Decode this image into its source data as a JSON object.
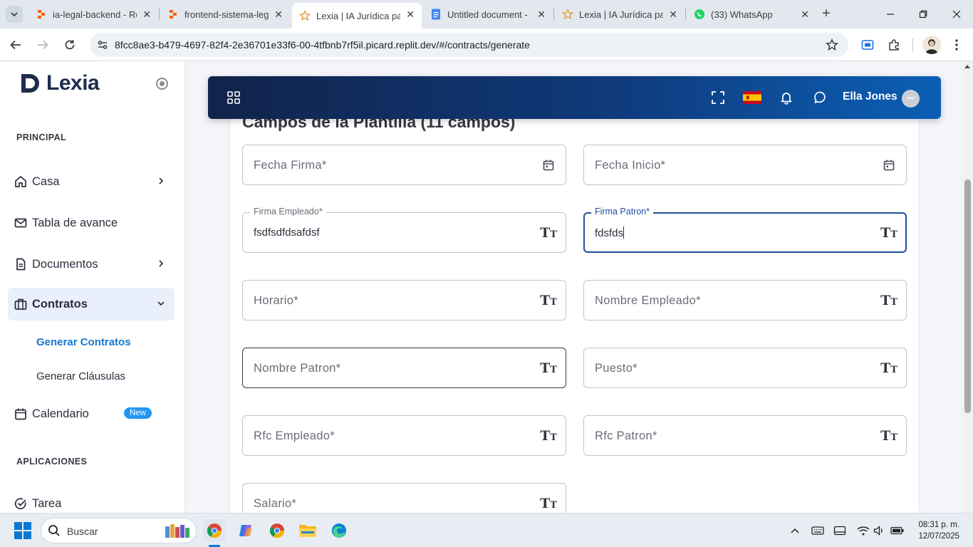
{
  "browser": {
    "tabs": [
      {
        "title": "ia-legal-backend - Re",
        "icon": "replit-icon",
        "active": false
      },
      {
        "title": "frontend-sistema-leg",
        "icon": "replit-icon",
        "active": false
      },
      {
        "title": "Lexia | IA Jurídica par",
        "icon": "star-favicon",
        "active": true
      },
      {
        "title": "Untitled document - ",
        "icon": "google-docs-icon",
        "active": false
      },
      {
        "title": "Lexia | IA Jurídica par",
        "icon": "star-favicon",
        "active": false
      },
      {
        "title": "(33) WhatsApp",
        "icon": "whatsapp-icon",
        "active": false
      }
    ],
    "url": "8fcc8ae3-b479-4697-82f4-2e36701e33f6-00-4tfbnb7rf5il.picard.replit.dev/#/contracts/generate"
  },
  "sidebar": {
    "brand": "Lexia",
    "section_principal": "PRINCIPAL",
    "section_apps": "APLICACIONES",
    "items": [
      {
        "label": "Casa",
        "icon": "home-icon"
      },
      {
        "label": "Tabla de avance",
        "icon": "mail-icon"
      },
      {
        "label": "Documentos",
        "icon": "document-icon"
      },
      {
        "label": "Contratos",
        "icon": "briefcase-icon"
      },
      {
        "label": "Calendario",
        "icon": "calendar-icon",
        "badge": "New"
      },
      {
        "label": "Tarea",
        "icon": "check-circle-icon"
      }
    ],
    "sub_items": [
      {
        "label": "Generar Contratos",
        "selected": true
      },
      {
        "label": "Generar Cláusulas",
        "selected": false
      }
    ]
  },
  "appbar": {
    "user_name": "Ella Jones",
    "user_initials": "•••",
    "language_flag": "spain-flag"
  },
  "form": {
    "title": "Campos de la Plantilla (11 campos)",
    "fields": {
      "fecha_firma": {
        "label": "Fecha Firma*",
        "value": ""
      },
      "fecha_inicio": {
        "label": "Fecha Inicio*",
        "value": ""
      },
      "firma_empleado": {
        "label": "Firma Empleado*",
        "value": "fsdfsdfdsafdsf"
      },
      "firma_patron": {
        "label": "Firma Patron*",
        "value": "fdsfds"
      },
      "horario": {
        "label": "Horario*",
        "value": ""
      },
      "nombre_empleado": {
        "label": "Nombre Empleado*",
        "value": ""
      },
      "nombre_patron": {
        "label": "Nombre Patron*",
        "value": ""
      },
      "puesto": {
        "label": "Puesto*",
        "value": ""
      },
      "rfc_empleado": {
        "label": "Rfc Empleado*",
        "value": ""
      },
      "rfc_patron": {
        "label": "Rfc Patron*",
        "value": ""
      },
      "salario": {
        "label": "Salario*",
        "value": ""
      }
    }
  },
  "taskbar": {
    "search_placeholder": "Buscar",
    "time": "08:31 p. m.",
    "date": "12/07/2025"
  },
  "colors": {
    "accent": "#1976d2",
    "appbar_start": "#10234a",
    "appbar_end": "#0c5fb6",
    "badge": "#2196f3"
  }
}
